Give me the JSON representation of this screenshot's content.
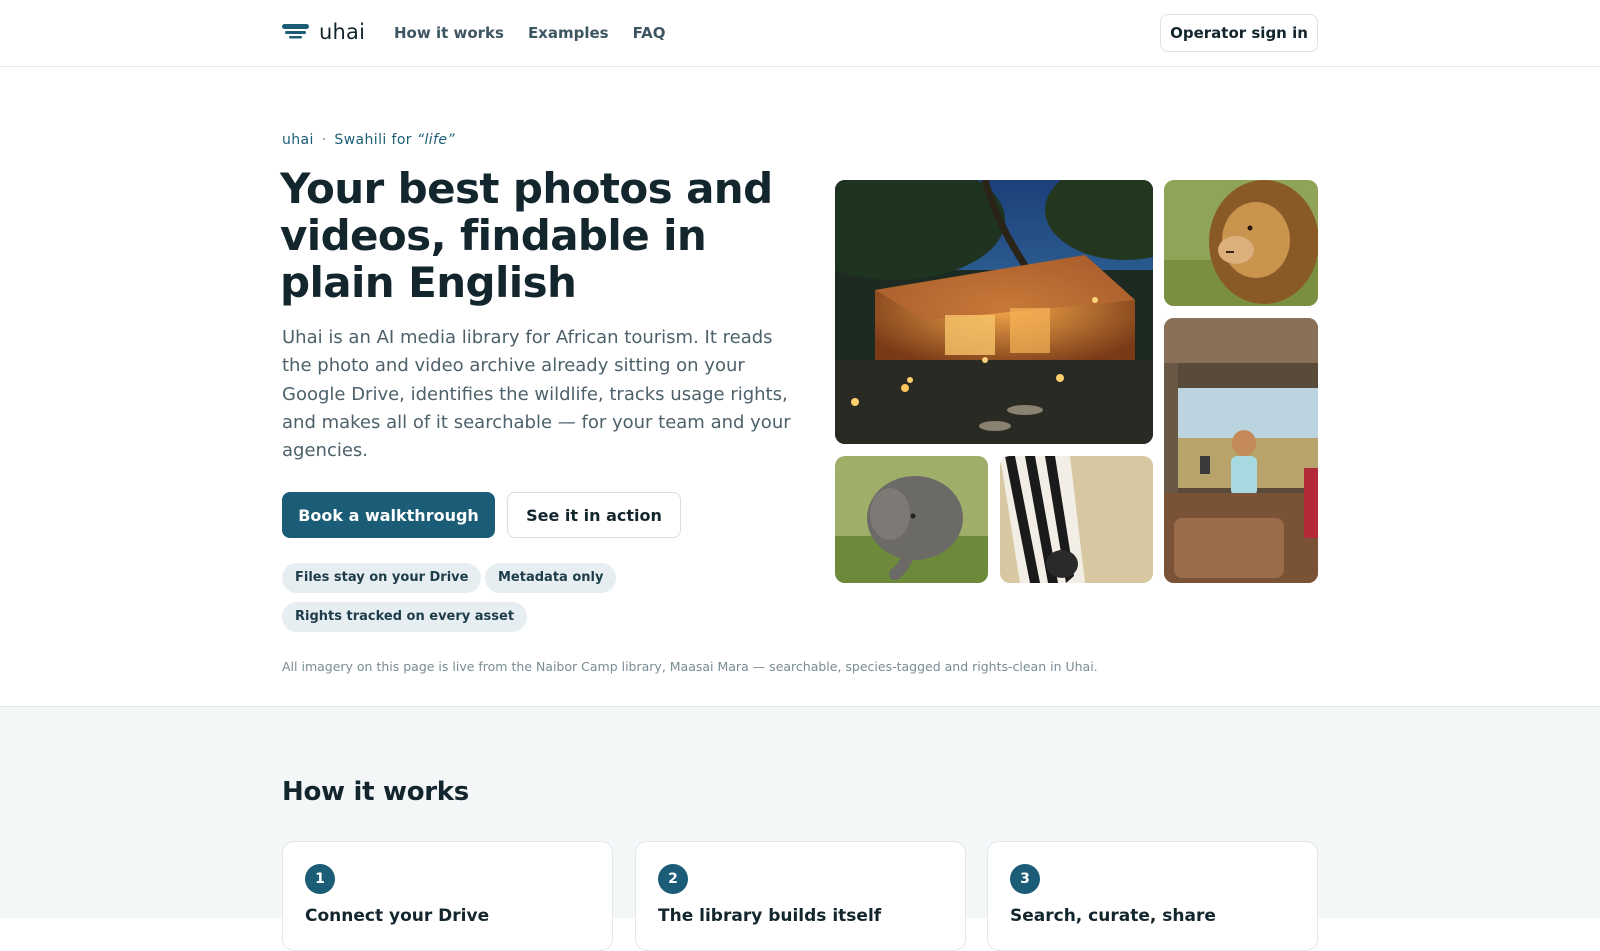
{
  "header": {
    "brand": "uhai",
    "nav": [
      "How it works",
      "Examples",
      "FAQ"
    ],
    "signin_label": "Operator sign in"
  },
  "hero": {
    "eyebrow_brand": "uhai",
    "eyebrow_separator": "·",
    "eyebrow_prefix": "Swahili for",
    "eyebrow_word": "“life”",
    "title": "Your best photos and videos, findable in plain English",
    "description": "Uhai is an AI media library for African tourism. It reads the photo and video archive already sitting on your Google Drive, identifies the wildlife, tracks usage rights, and makes all of it searchable — for your team and your agencies.",
    "primary_cta": "Book a walkthrough",
    "secondary_cta": "See it in action",
    "pills": [
      "Files stay on your Drive",
      "Metadata only",
      "Rights tracked on every asset"
    ],
    "caption": "All imagery on this page is live from the Naibor Camp library, Maasai Mara — searchable, species-tagged and rights-clean in Uhai."
  },
  "gallery": {
    "tiles": [
      "camp-tent-at-night",
      "lion-portrait",
      "child-in-safari-vehicle",
      "elephant-calf",
      "zebra-head"
    ]
  },
  "how_it_works": {
    "title": "How it works",
    "steps": [
      {
        "number": "1",
        "title": "Connect your Drive"
      },
      {
        "number": "2",
        "title": "The library builds itself"
      },
      {
        "number": "3",
        "title": "Search, curate, share"
      }
    ]
  },
  "colors": {
    "brand_teal": "#1b5d76",
    "text_dark": "#13262d",
    "pill_bg": "#e6eef1",
    "section_bg": "#f4f7f8"
  }
}
